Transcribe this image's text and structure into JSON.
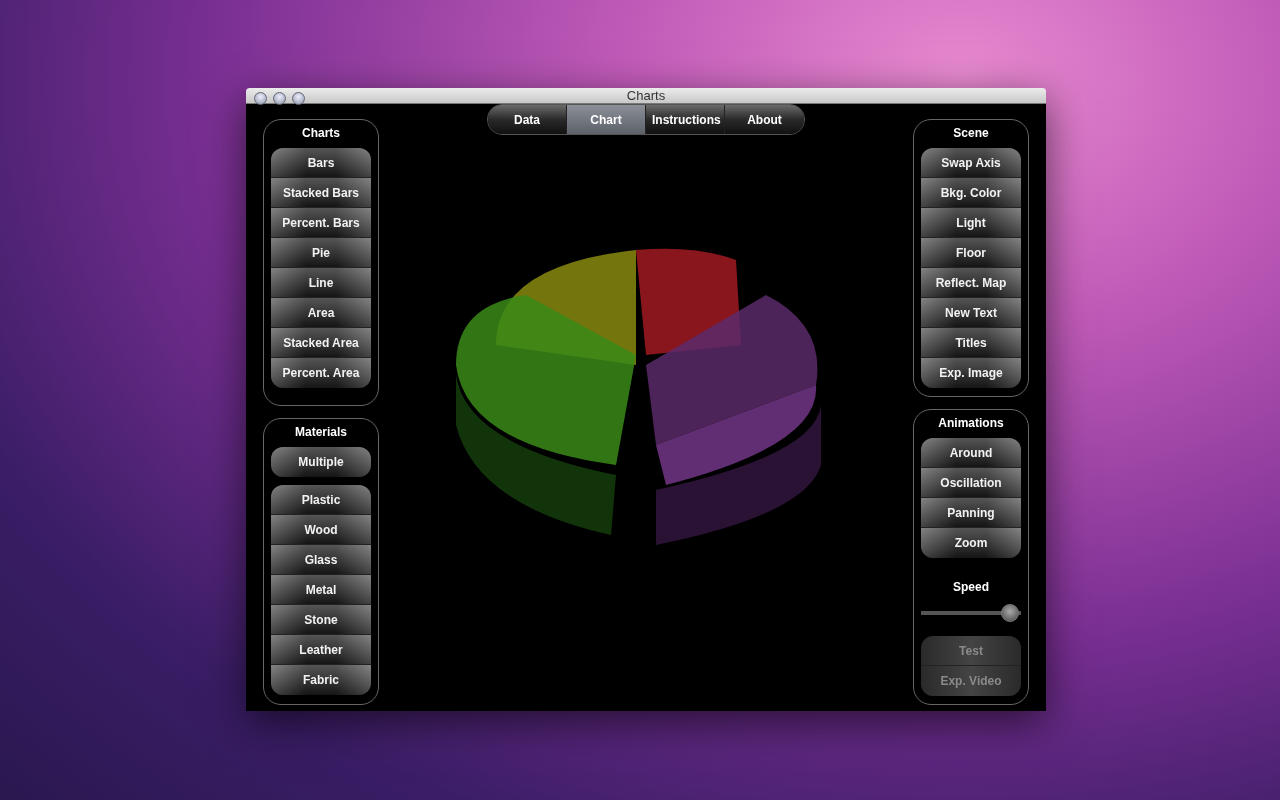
{
  "window": {
    "title": "Charts"
  },
  "tabs": [
    {
      "label": "Data",
      "selected": false
    },
    {
      "label": "Chart",
      "selected": true
    },
    {
      "label": "Instructions",
      "selected": false
    },
    {
      "label": "About",
      "selected": false
    }
  ],
  "left_panels": [
    {
      "title": "Charts",
      "groups": [
        [
          {
            "label": "Bars",
            "disabled": false
          },
          {
            "label": "Stacked Bars",
            "disabled": false
          },
          {
            "label": "Percent. Bars",
            "disabled": false
          },
          {
            "label": "Pie",
            "disabled": false
          },
          {
            "label": "Line",
            "disabled": false
          },
          {
            "label": "Area",
            "disabled": false
          },
          {
            "label": "Stacked Area",
            "disabled": false
          },
          {
            "label": "Percent. Area",
            "disabled": false
          }
        ]
      ]
    },
    {
      "title": "Materials",
      "groups": [
        [
          {
            "label": "Multiple",
            "disabled": false
          }
        ],
        [
          {
            "label": "Plastic",
            "disabled": false
          },
          {
            "label": "Wood",
            "disabled": false
          },
          {
            "label": "Glass",
            "disabled": false
          },
          {
            "label": "Metal",
            "disabled": false
          },
          {
            "label": "Stone",
            "disabled": false
          },
          {
            "label": "Leather",
            "disabled": false
          },
          {
            "label": "Fabric",
            "disabled": false
          }
        ]
      ]
    }
  ],
  "right_panels": [
    {
      "title": "Scene",
      "groups": [
        [
          {
            "label": "Swap Axis",
            "disabled": false
          },
          {
            "label": "Bkg. Color",
            "disabled": false
          },
          {
            "label": "Light",
            "disabled": false
          },
          {
            "label": "Floor",
            "disabled": false
          },
          {
            "label": "Reflect. Map",
            "disabled": false
          },
          {
            "label": "New Text",
            "disabled": false
          },
          {
            "label": "Titles",
            "disabled": false
          },
          {
            "label": "Exp. Image",
            "disabled": false
          }
        ]
      ]
    },
    {
      "title": "Animations",
      "groups": [
        [
          {
            "label": "Around",
            "disabled": false
          },
          {
            "label": "Oscillation",
            "disabled": false
          },
          {
            "label": "Panning",
            "disabled": false
          },
          {
            "label": "Zoom",
            "disabled": false
          }
        ]
      ],
      "speed": {
        "label": "Speed",
        "level": 0.97
      },
      "after_groups": [
        [
          {
            "label": "Test",
            "disabled": true
          },
          {
            "label": "Exp. Video",
            "disabled": true
          }
        ]
      ]
    }
  ]
}
